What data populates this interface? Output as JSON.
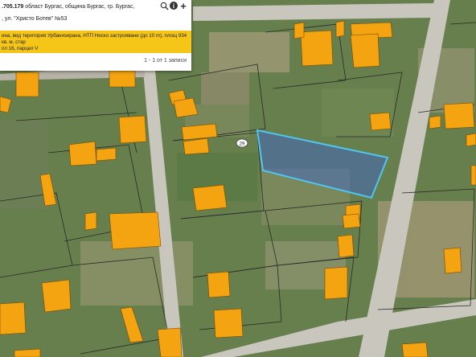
{
  "panel": {
    "title_bold": ".705.179",
    "title_rest": " област Бургас, община Бургас, гр. Бургас,",
    "subline": ", ул. \"Христо Ботев\" №53",
    "attributes": "ина, вид територия Урбанизирана, НТП Ниско застрояване (до 10 m), площ 934 кв. м, стар\nпл 16, парцел V",
    "pager": "1 - 1 от 1 записи"
  },
  "icons": {
    "search": "search-icon",
    "info": "info-icon",
    "plus": "plus-icon",
    "expand": "expand-icon"
  },
  "map": {
    "house_number_label": "29",
    "colors": {
      "building": "#f4a410",
      "building_outline": "#7a4a00",
      "parcel_fill": "#3c64d2",
      "parcel_outline": "#4fc6f2",
      "road": "#c9c6be",
      "plot_line": "#2a2a2a"
    }
  }
}
